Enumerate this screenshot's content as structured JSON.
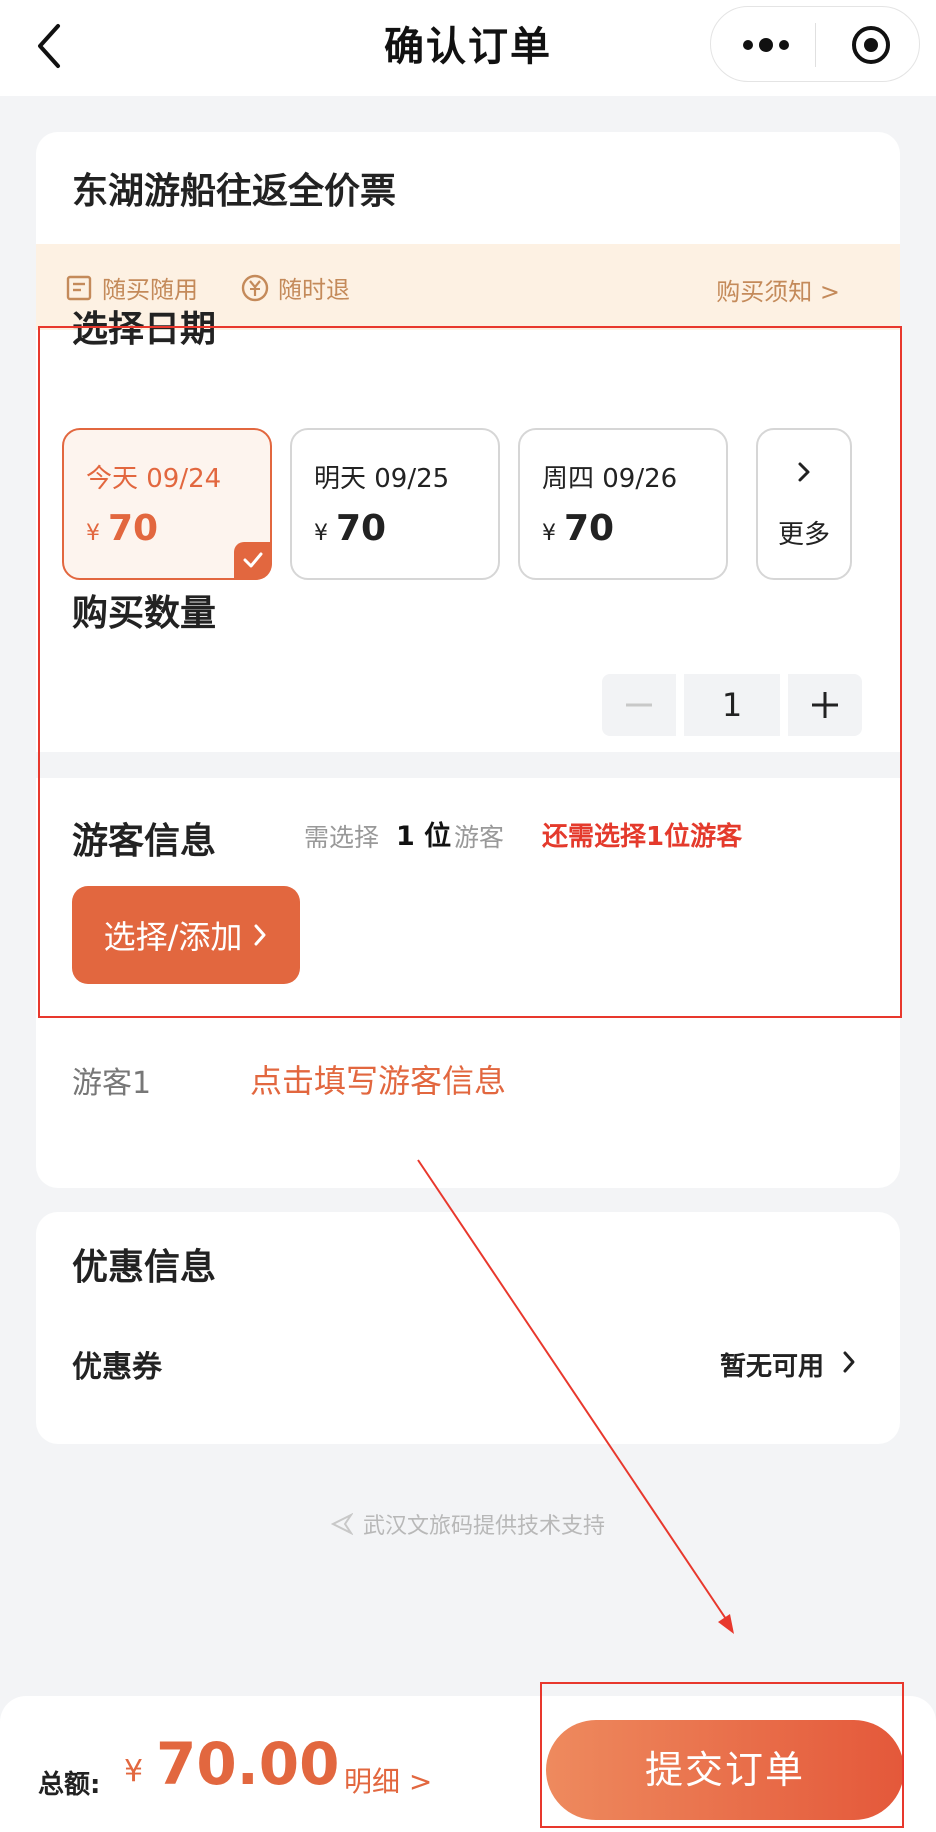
{
  "header": {
    "title": "确认订单"
  },
  "ticket": {
    "name": "东湖游船往返全价票"
  },
  "notice": {
    "item1": "随买随用",
    "item2": "随时退",
    "link": "购买须知 >"
  },
  "date_section": {
    "title": "选择日期",
    "dates": [
      {
        "label": "今天 09/24",
        "currency": "¥",
        "price": "70",
        "selected": true
      },
      {
        "label": "明天 09/25",
        "currency": "¥",
        "price": "70",
        "selected": false
      },
      {
        "label": "周四 09/26",
        "currency": "¥",
        "price": "70",
        "selected": false
      }
    ],
    "more_label": "更多"
  },
  "quantity": {
    "label": "购买数量",
    "value": "1"
  },
  "visitor_section": {
    "title": "游客信息",
    "need_prefix": "需选择",
    "need_count": "1 位",
    "need_suffix": "游客",
    "warning": "还需选择1位游客",
    "add_button": "选择/添加",
    "visitor_label": "游客1",
    "fill_link": "点击填写游客信息"
  },
  "discount_section": {
    "title": "优惠信息",
    "coupon_label": "优惠券",
    "coupon_value": "暂无可用"
  },
  "footer": {
    "note": "武汉文旅码提供技术支持"
  },
  "bottom_bar": {
    "total_label": "总额:",
    "currency": "¥",
    "total_amount": "70.00",
    "detail_link": "明细 >",
    "submit_label": "提交订单"
  },
  "colors": {
    "accent": "#e2673f",
    "warning": "#e43a2c",
    "annotation": "#e8382d"
  }
}
